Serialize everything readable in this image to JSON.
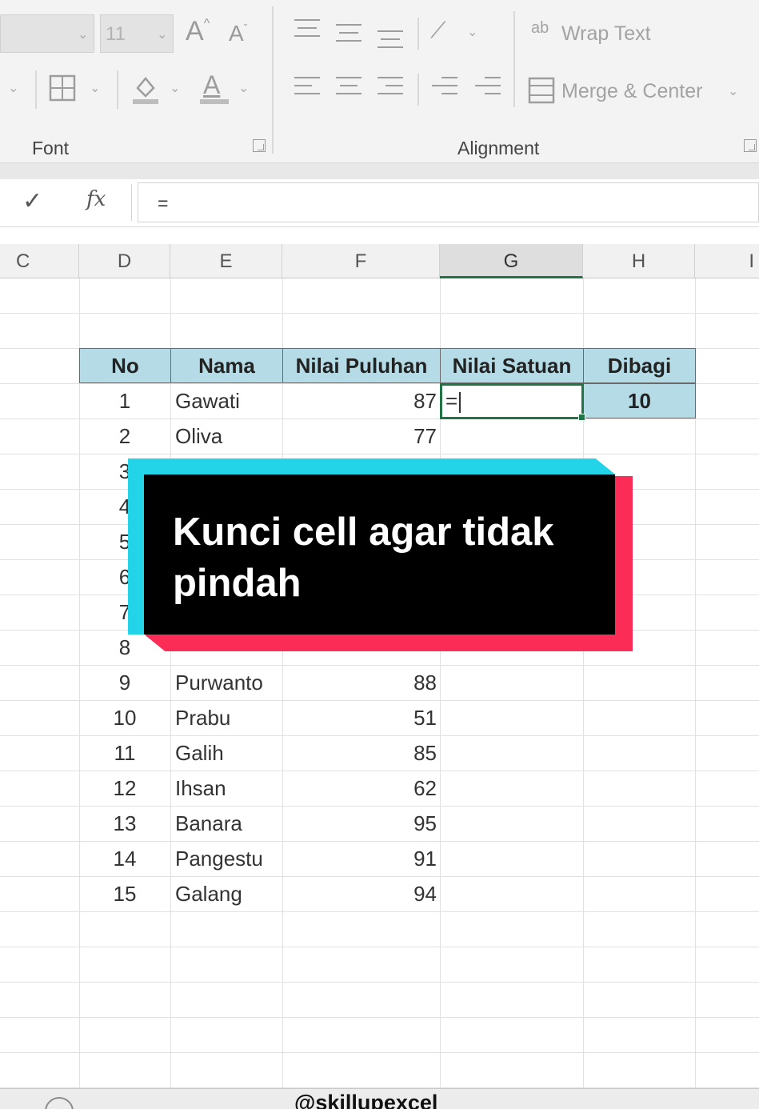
{
  "ribbon": {
    "font_size_value": "11",
    "font_group_label": "Font",
    "alignment_group_label": "Alignment",
    "wrap_text_label": "Wrap Text",
    "merge_center_label": "Merge & Center",
    "wrap_text_icon_glyph": "ab",
    "increase_font_glyph": "A",
    "decrease_font_glyph": "A",
    "font_color_glyph": "A",
    "accent_underline_color": "#9d9d9d"
  },
  "formula_bar": {
    "enter_glyph": "✓",
    "fx_label": "fx",
    "formula_value": "="
  },
  "columns": [
    "C",
    "D",
    "E",
    "F",
    "G",
    "H",
    "I"
  ],
  "active_column": "G",
  "table": {
    "headers": [
      "No",
      "Nama",
      "Nilai Puluhan",
      "Nilai Satuan",
      "Dibagi"
    ],
    "divisor": "10",
    "active_cell_value": "=",
    "rows": [
      {
        "no": "1",
        "nama": "Gawati",
        "nilai": "87"
      },
      {
        "no": "2",
        "nama": "Oliva",
        "nilai": "77"
      },
      {
        "no": "3",
        "nama": "",
        "nilai": ""
      },
      {
        "no": "4",
        "nama": "",
        "nilai": ""
      },
      {
        "no": "5",
        "nama": "",
        "nilai": ""
      },
      {
        "no": "6",
        "nama": "",
        "nilai": ""
      },
      {
        "no": "7",
        "nama": "",
        "nilai": ""
      },
      {
        "no": "8",
        "nama": "",
        "nilai": ""
      },
      {
        "no": "9",
        "nama": "Purwanto",
        "nilai": "88"
      },
      {
        "no": "10",
        "nama": "Prabu",
        "nilai": "51"
      },
      {
        "no": "11",
        "nama": "Galih",
        "nilai": "85"
      },
      {
        "no": "12",
        "nama": "Ihsan",
        "nilai": "62"
      },
      {
        "no": "13",
        "nama": "Banara",
        "nilai": "95"
      },
      {
        "no": "14",
        "nama": "Pangestu",
        "nilai": "91"
      },
      {
        "no": "15",
        "nama": "Galang",
        "nilai": "94"
      }
    ]
  },
  "caption": {
    "text": "Kunci cell agar tidak pindah",
    "colors": {
      "cyan": "#23d3e8",
      "red": "#fb2c55",
      "black": "#000000"
    }
  },
  "watermark": "@skillupexcel",
  "colors": {
    "header_fill": "#b4dbe6",
    "active_cell_border": "#227447",
    "ribbon_bg": "#f3f3f3"
  }
}
